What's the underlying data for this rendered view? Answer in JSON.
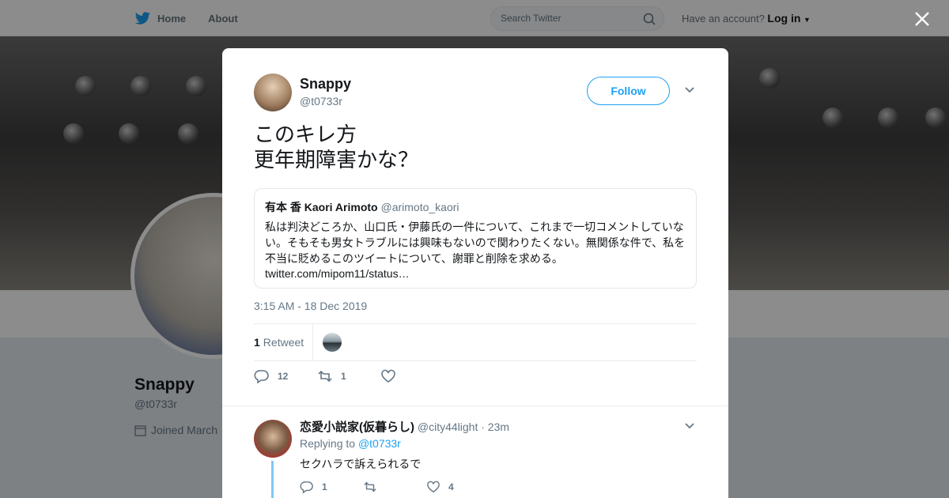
{
  "topbar": {
    "home_label": "Home",
    "about_label": "About",
    "search_placeholder": "Search Twitter",
    "account_prompt": "Have an account?",
    "login_label": "Log in"
  },
  "profile": {
    "name": "Snappy",
    "handle": "@t0733r",
    "joined": "Joined March"
  },
  "tweet": {
    "author_name": "Snappy",
    "author_handle": "@t0733r",
    "follow_label": "Follow",
    "text": "このキレ方\n更年期障害かな？",
    "quote": {
      "author_name": "有本 香 Kaori Arimoto",
      "author_handle": "@arimoto_kaori",
      "text": "私は判決どころか、山口氏・伊藤氏の一件について、これまで一切コメントしていない。そもそも男女トラブルには興味もないので関わりたくない。無関係な件で、私を不当に貶めるこのツイートについて、謝罪と削除を求める。",
      "link": "twitter.com/mipom11/status…"
    },
    "timestamp": "3:15 AM - 18 Dec 2019",
    "retweet_count": "1",
    "retweet_label": "Retweet",
    "reply_count": "12",
    "rt_action_count": "1",
    "like_count": ""
  },
  "reply": {
    "author_name": "恋愛小説家(仮暮らし)",
    "author_handle": "@city44light",
    "time": "· 23m",
    "replying_prefix": "Replying to",
    "replying_to": "@t0733r",
    "text": "セクハラで訴えられるで",
    "reply_count": "1",
    "retweet_count": "",
    "like_count": "4"
  },
  "colors": {
    "accent": "#1da1f2",
    "muted": "#657786",
    "thread": "#7fc7f5"
  }
}
